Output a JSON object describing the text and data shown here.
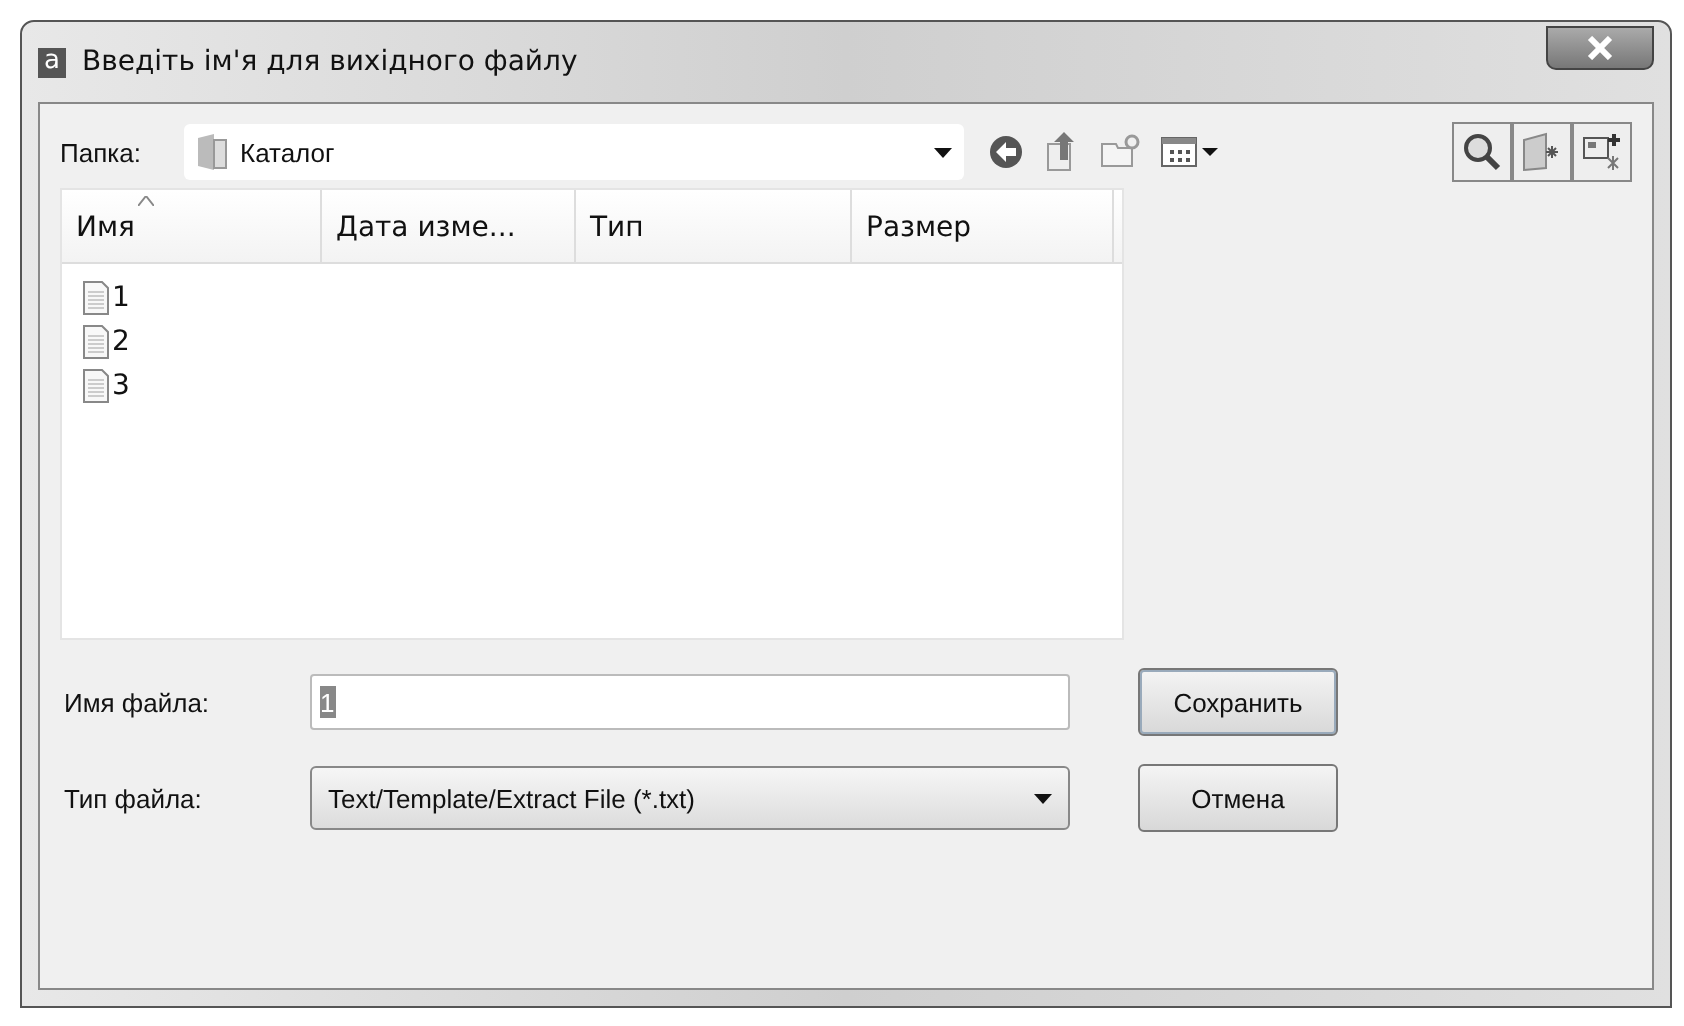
{
  "window": {
    "app_icon": "a",
    "title": "Введіть ім'я для вихідного файлу"
  },
  "folder": {
    "label": "Папка:",
    "value": "Каталог"
  },
  "list": {
    "columns": [
      {
        "label": "Имя",
        "sorted": true
      },
      {
        "label": "Дата изме...",
        "sorted": false
      },
      {
        "label": "Тип",
        "sorted": false
      },
      {
        "label": "Размер",
        "sorted": false
      }
    ],
    "files": [
      {
        "name": "1"
      },
      {
        "name": "2"
      },
      {
        "name": "3"
      }
    ]
  },
  "file_name": {
    "label": "Имя файла:",
    "value": "1",
    "value_selected": true
  },
  "file_type": {
    "label": "Тип файла:",
    "value": "Text/Template/Extract File (*.txt)"
  },
  "buttons": [
    {
      "label": "Сохранить",
      "kind": "default"
    },
    {
      "label": "Отмена",
      "kind": "normal"
    }
  ]
}
